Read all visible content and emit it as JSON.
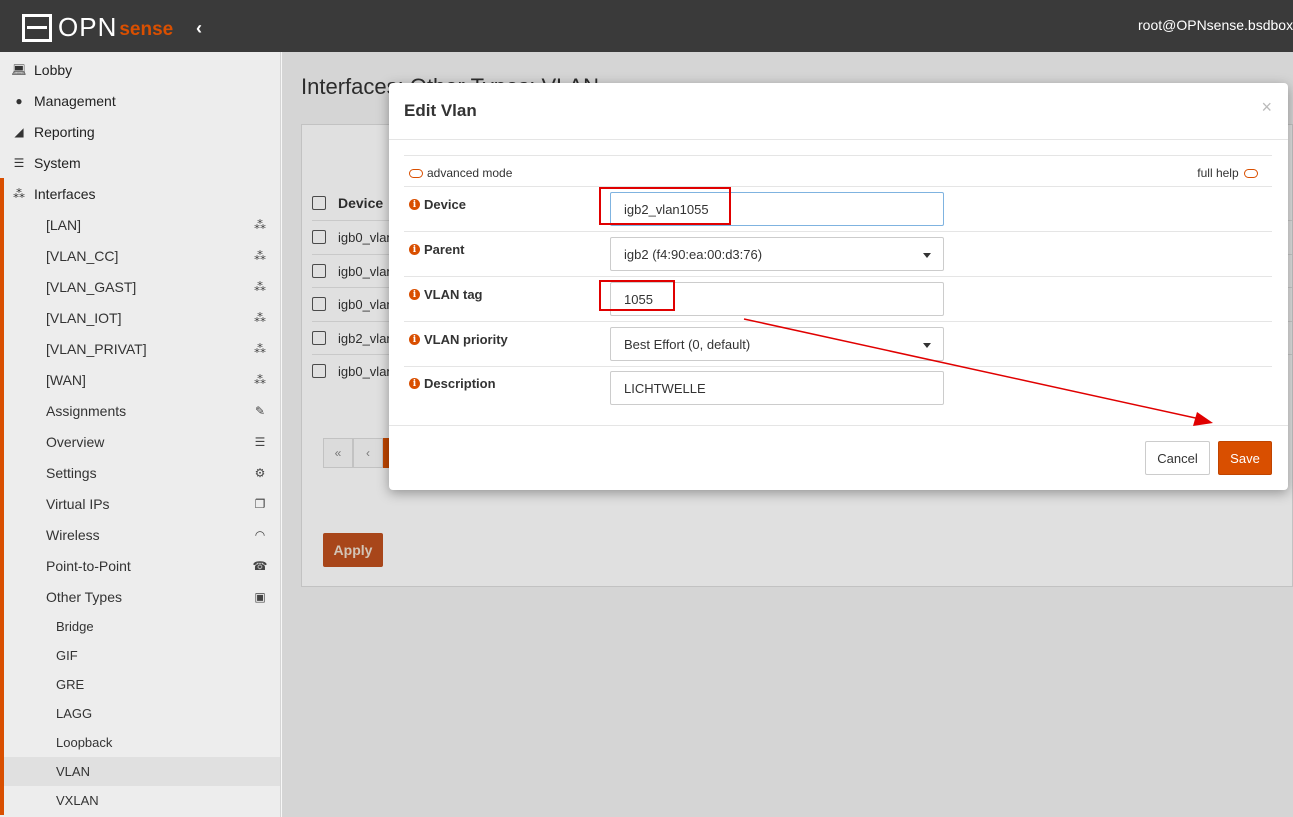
{
  "app": {
    "logo_opn": "OPN",
    "logo_sense": "sense",
    "user": "root@OPNsense.bsdbox.lc"
  },
  "sidebar": {
    "top_items": [
      {
        "label": "Lobby",
        "icon": "laptop-icon"
      },
      {
        "label": "Management",
        "icon": "globe-icon"
      },
      {
        "label": "Reporting",
        "icon": "area-chart-icon"
      },
      {
        "label": "System",
        "icon": "server-icon"
      },
      {
        "label": "Interfaces",
        "icon": "sitemap-icon"
      }
    ],
    "interfaces": [
      {
        "label": "[LAN]",
        "icon": "sitemap-icon"
      },
      {
        "label": "[VLAN_CC]",
        "icon": "sitemap-icon"
      },
      {
        "label": "[VLAN_GAST]",
        "icon": "sitemap-icon"
      },
      {
        "label": "[VLAN_IOT]",
        "icon": "sitemap-icon"
      },
      {
        "label": "[VLAN_PRIVAT]",
        "icon": "sitemap-icon"
      },
      {
        "label": "[WAN]",
        "icon": "sitemap-icon"
      },
      {
        "label": "Assignments",
        "icon": "pencil-icon"
      },
      {
        "label": "Overview",
        "icon": "list-icon"
      },
      {
        "label": "Settings",
        "icon": "cogs-icon"
      },
      {
        "label": "Virtual IPs",
        "icon": "clone-icon"
      },
      {
        "label": "Wireless",
        "icon": "wifi-icon"
      },
      {
        "label": "Point-to-Point",
        "icon": "phone-icon"
      },
      {
        "label": "Other Types",
        "icon": "archive-icon"
      }
    ],
    "other_types": [
      "Bridge",
      "GIF",
      "GRE",
      "LAGG",
      "Loopback",
      "VLAN",
      "VXLAN"
    ],
    "active": "VLAN"
  },
  "page": {
    "title": "Interfaces: Other Types: VLAN",
    "table_header": "Device",
    "rows": [
      "igb0_vlan",
      "igb0_vlan",
      "igb0_vlan",
      "igb2_vlan",
      "igb0_vlan"
    ],
    "pager": [
      "«",
      "‹"
    ],
    "apply_label": "Apply"
  },
  "modal": {
    "title": "Edit Vlan",
    "close": "×",
    "advanced_mode": "advanced mode",
    "full_help": "full help",
    "fields": {
      "device": {
        "label": "Device",
        "value": "igb2_vlan1055"
      },
      "parent": {
        "label": "Parent",
        "value": "igb2 (f4:90:ea:00:d3:76)"
      },
      "vlan_tag": {
        "label": "VLAN tag",
        "value": "1055"
      },
      "vlan_priority": {
        "label": "VLAN priority",
        "value": "Best Effort (0, default)"
      },
      "description": {
        "label": "Description",
        "value": "LICHTWELLE"
      }
    },
    "cancel_label": "Cancel",
    "save_label": "Save"
  },
  "colors": {
    "accent": "#d94f00",
    "topbar": "#3a3a3a",
    "annotation": "#e00000"
  }
}
